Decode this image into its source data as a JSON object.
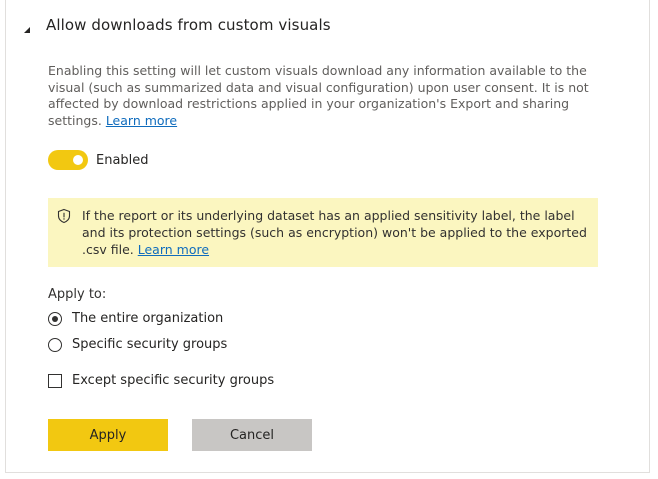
{
  "section": {
    "title": "Allow downloads from custom visuals",
    "collapse_icon": "caret-down-icon"
  },
  "description": {
    "text": "Enabling this setting will let custom visuals download any information available to the visual (such as summarized data and visual configuration) upon user consent. It is not affected by download restrictions applied in your organization's Export and sharing settings.",
    "link": "Learn more"
  },
  "toggle": {
    "label": "Enabled",
    "on": true,
    "color": "#f2c811"
  },
  "warning": {
    "icon": "shield-icon",
    "text": "If the report or its underlying dataset has an applied sensitivity label, the label and its protection settings (such as encryption) won't be applied to the exported .csv file.",
    "link": "Learn more",
    "background": "#fbf6c0"
  },
  "apply_to": {
    "label": "Apply to:",
    "options": [
      {
        "label": "The entire organization",
        "selected": true
      },
      {
        "label": "Specific security groups",
        "selected": false
      }
    ]
  },
  "except_checkbox": {
    "label": "Except specific security groups",
    "checked": false
  },
  "buttons": {
    "apply": "Apply",
    "cancel": "Cancel"
  }
}
